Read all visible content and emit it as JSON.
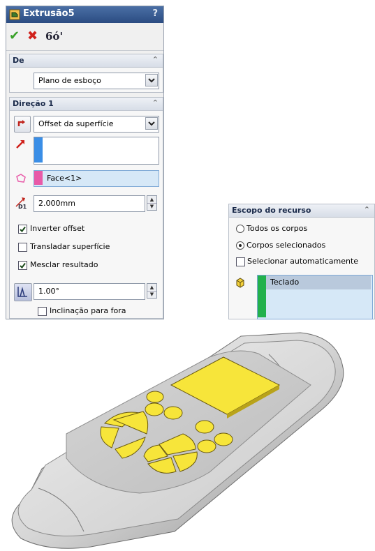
{
  "feature": {
    "title": "Extrusão5",
    "help": "?"
  },
  "toolbar": {
    "ok_label": "✔",
    "cancel_label": "✖",
    "preview_label": "6ó'"
  },
  "from_group": {
    "title": "De",
    "selected": "Plano de esboço"
  },
  "direction1": {
    "title": "Direção 1",
    "end_condition": "Offset da superfície",
    "face_value": "Face<1>",
    "offset_distance": "2.000mm",
    "reverse_offset_label": "Inverter offset",
    "reverse_offset": true,
    "translate_surface_label": "Transladar superfície",
    "translate_surface": false,
    "merge_result_label": "Mesclar resultado",
    "merge_result": true,
    "draft_angle": "1.00°",
    "draft_outward_label": "Inclinação para fora",
    "draft_outward": false
  },
  "scope": {
    "title": "Escopo do recurso",
    "all_bodies_label": "Todos os corpos",
    "selected_bodies_label": "Corpos selecionados",
    "auto_select_label": "Selecionar automaticamente",
    "selected_option": "Corpos selecionados",
    "auto_select": false,
    "bodies": [
      "Teclado"
    ]
  },
  "colors": {
    "accent_blue": "#3a8ee6",
    "face_pink": "#e85aa8",
    "body_green": "#22b14c",
    "key_yellow": "#f7e53a",
    "ok_green": "#3aa12a",
    "cancel_red": "#d0211b"
  }
}
